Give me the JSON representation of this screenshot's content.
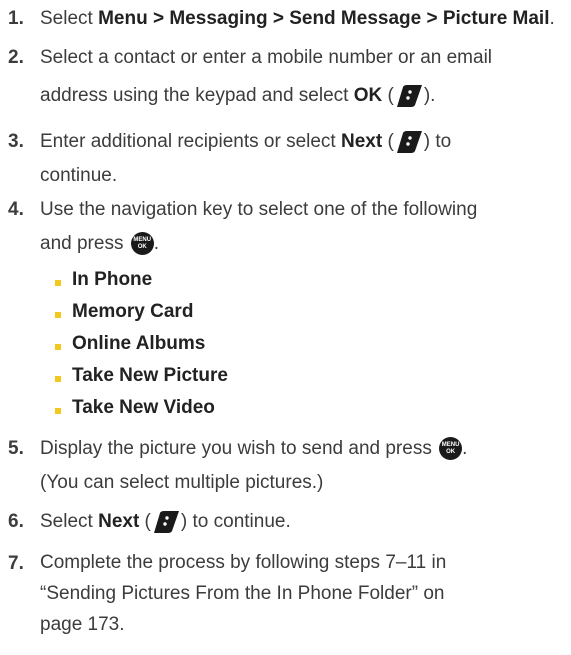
{
  "steps": [
    {
      "num": "1.",
      "pre": "Select ",
      "bold": "Menu > Messaging > Send Message > Picture Mail",
      "post": "."
    },
    {
      "num": "2.",
      "line1": "Select a contact or enter a mobile number or an email",
      "pre": "address using the keypad and select ",
      "bold": "OK",
      "open": " (",
      "close": ")."
    },
    {
      "num": "3.",
      "pre": "Enter additional recipients or select ",
      "bold": "Next",
      "open": " (",
      "close": ") to",
      "line2": "continue."
    },
    {
      "num": "4.",
      "line1": "Use the navigation key to select one of the following",
      "pre": "and press ",
      "post": "."
    },
    {
      "num": "5.",
      "pre": "Display the picture you wish to send and press ",
      "post": ".",
      "line2": "(You can select multiple pictures.)"
    },
    {
      "num": "6.",
      "pre": "Select ",
      "bold": "Next",
      "open": " (",
      "close": ") to continue."
    },
    {
      "num": "7.",
      "line1": "Complete the process by following steps 7–11 in",
      "line2": "“Sending Pictures From the In Phone Folder” on",
      "line3": "page 173."
    }
  ],
  "options": [
    "In Phone",
    "Memory Card",
    "Online Albums",
    "Take New Picture",
    "Take New Video"
  ],
  "menu_key": {
    "top": "MENU",
    "bottom": "OK"
  },
  "colors": {
    "bullet": "#f2c81a",
    "text": "#3c3c3c",
    "key": "#1a1a1a"
  },
  "icons": {
    "softkey": "softkey-icon",
    "menu_ok": "menu-ok-key-icon"
  }
}
